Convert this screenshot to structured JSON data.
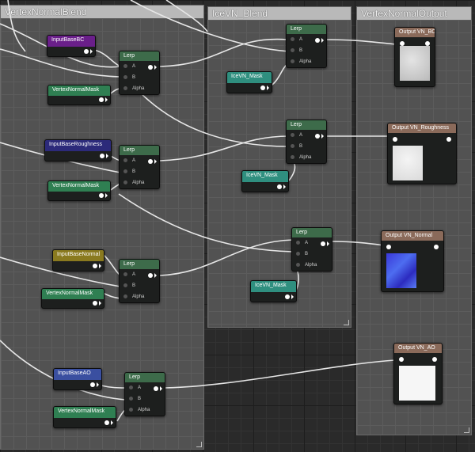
{
  "groups": {
    "vertex_normal_blend": "VertexNormalBlend",
    "ice_vn_blend": "IceVN_Blend",
    "vertex_normal_output": "VertexNormalOutput"
  },
  "lerp": {
    "title": "Lerp",
    "pin_a": "A",
    "pin_b": "B",
    "pin_alpha": "Alpha"
  },
  "params": {
    "input_base_bc": "InputBaseBC",
    "input_base_roughness": "InputBaseRoughness",
    "input_base_normal": "InputBaseNormal",
    "input_base_ao": "InputBaseAO",
    "vertex_normal_mask": "VertexNormalMask",
    "ice_vn_mask": "IceVN_Mask"
  },
  "outputs": {
    "bc": "Output VN_BC",
    "roughness": "Output VN_Roughness",
    "normal": "Output VN_Normal",
    "ao": "Output VN_AO"
  },
  "colors": {
    "lerp_header": "#3d6b4a",
    "bc_param": "#6a1f8a",
    "roughness_param": "#2c2a7a",
    "normal_param": "#8a7a1f",
    "ao_param": "#3a4fa0",
    "mask_param": "#2f7f52",
    "ice_mask_param": "#2f8f7f",
    "output_header": "#8a6a5a"
  }
}
